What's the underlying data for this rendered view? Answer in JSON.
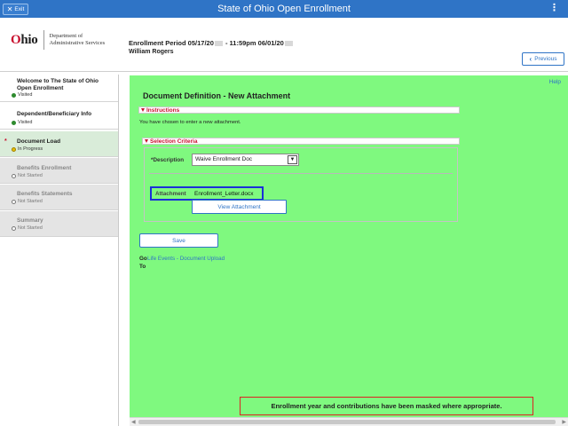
{
  "topbar": {
    "exit_label": "Exit",
    "title": "State of Ohio Open Enrollment",
    "menu_glyph": "⋮"
  },
  "header": {
    "logo_O": "O",
    "logo_rest": "hio",
    "logo_sub_line1": "Department of",
    "logo_sub_line2": "Administrative Services",
    "period_prefix": "Enrollment Period 05/17/20",
    "period_mid": " - 11:59pm 06/01/20",
    "user_name": "William Rogers",
    "previous_label": "Previous"
  },
  "sidebar": {
    "steps": [
      {
        "title_line1": "Welcome to The State of Ohio",
        "title_line2": "Open Enrollment",
        "status": "Visited"
      },
      {
        "title_line1": "Dependent/Beneficiary Info",
        "status": "Visited"
      },
      {
        "title_line1": "Document Load",
        "status": "In Progress"
      },
      {
        "title_line1": "Benefits Enrollment",
        "status": "Not Started"
      },
      {
        "title_line1": "Benefits Statements",
        "status": "Not Started"
      },
      {
        "title_line1": "Summary",
        "status": "Not Started"
      }
    ]
  },
  "main": {
    "help": "Help",
    "page_title": "Document Definition - New Attachment",
    "instructions_header": "Instructions",
    "instructions_text": "You have chosen to enter a new attachment.",
    "selection_header": "Selection Criteria",
    "description_label": "*Description",
    "description_value": "Waive Enrollment Doc",
    "attachment_label": "Attachment",
    "attachment_file": "Enrollment_Letter.docx",
    "view_attachment": "View Attachment",
    "save": "Save",
    "goto_label_1": "Go",
    "goto_label_2": "To",
    "goto_link": "Life Events - Document Upload",
    "mask_note": "Enrollment year and contributions have been masked where appropriate."
  },
  "colors": {
    "topbar": "#2f74c6",
    "main_bg": "#7ff97f",
    "accent_red": "#c8102e",
    "attachment_border": "#1a2fd9"
  }
}
